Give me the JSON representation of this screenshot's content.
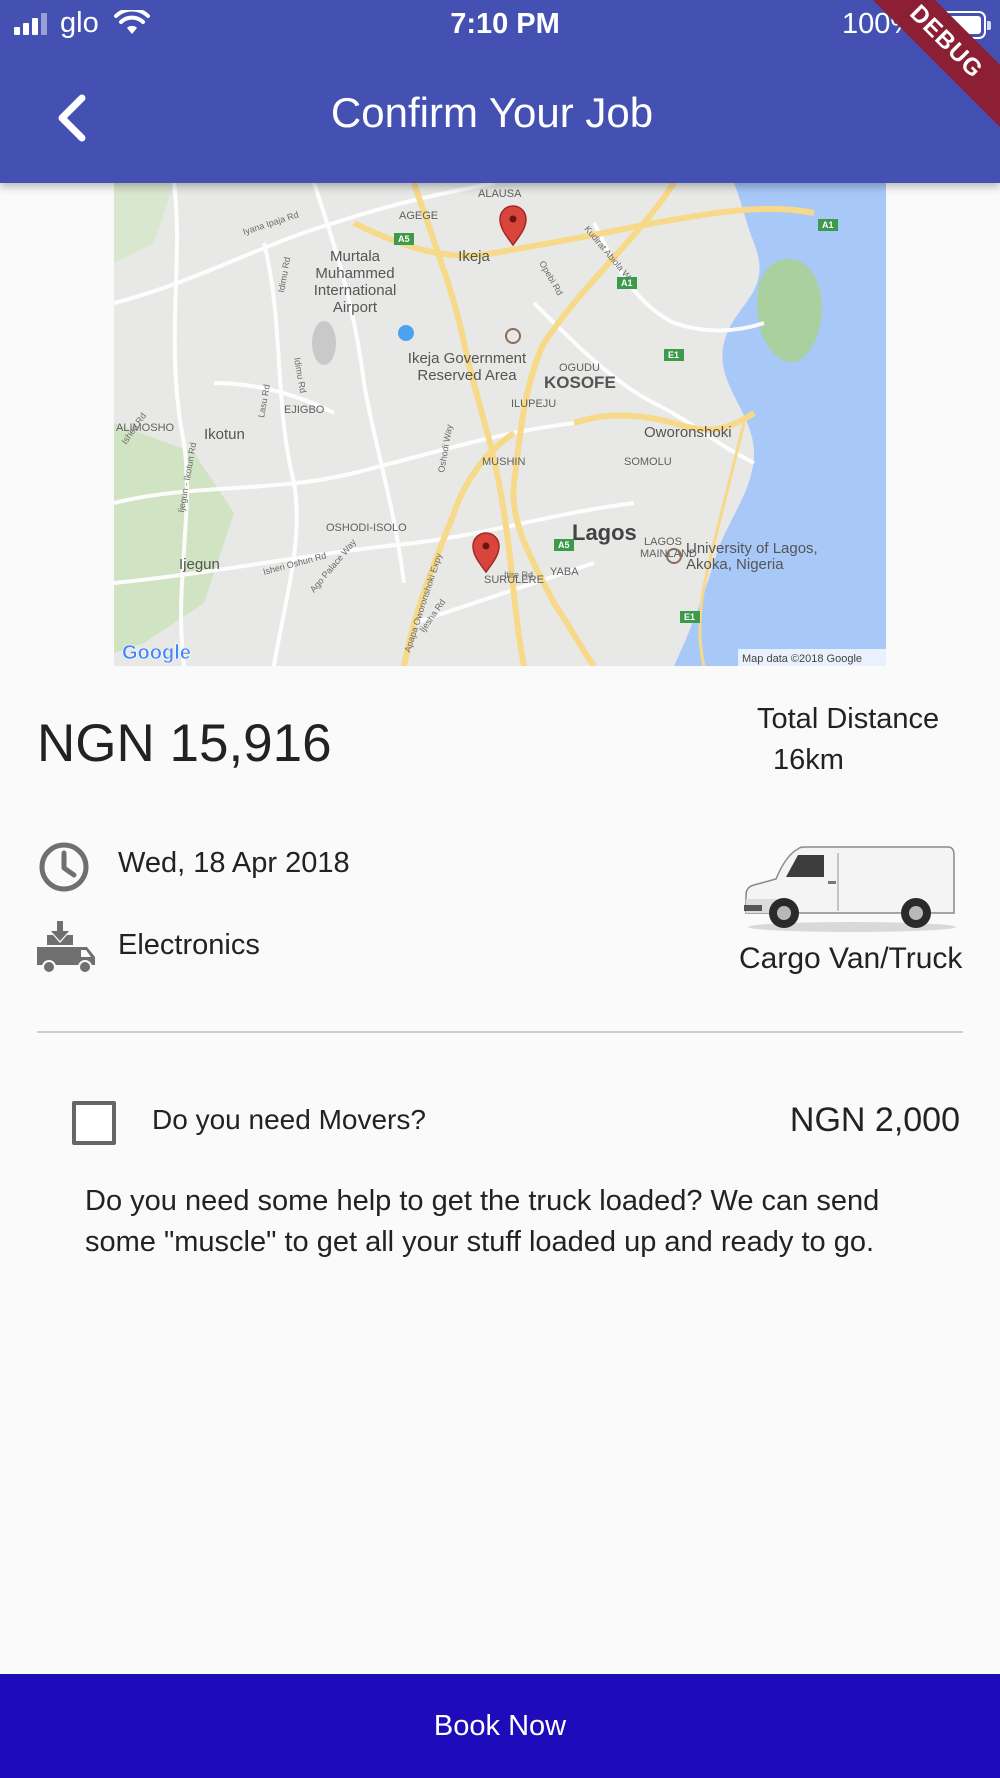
{
  "status_bar": {
    "carrier": "glo",
    "time": "7:10 PM",
    "battery_percent": "100%"
  },
  "app_bar": {
    "title": "Confirm Your Job",
    "debug_banner": "DEBUG"
  },
  "map": {
    "labels": {
      "alausa": "ALAUSA",
      "agege": "AGEGE",
      "airport_1": "Murtala",
      "airport_2": "Muhammed",
      "airport_3": "International",
      "airport_4": "Airport",
      "ikeja": "Ikeja",
      "gra_1": "Ikeja Government",
      "gra_2": "Reserved Area",
      "kosofe": "KOSOFE",
      "ogudu": "OGUDU",
      "oworonshoki": "Oworonshoki",
      "ikotun": "Ikotun",
      "ejigbo": "EJIGBO",
      "alimosho": "ALIMOSHO",
      "ilupeju": "ILUPEJU",
      "mushin": "MUSHIN",
      "somolu": "SOMOLU",
      "lagos": "Lagos",
      "unilag_1": "University of Lagos,",
      "unilag_2": "Akoka, Nigeria",
      "ijegun": "Ijegun",
      "oshodi": "OSHODI-ISOLO",
      "lagos_mainland_1": "LAGOS",
      "lagos_mainland_2": "MAINLAND",
      "yaba": "YABA",
      "surulere": "SURULERE",
      "apapa_exp": "Apapa Oworonshoki Expy",
      "iyana": "Iyana Ipaja Rd",
      "idimu": "Idimu Rd",
      "kudirat": "Kudirat Abiola Way",
      "opebi": "Opebi Rd",
      "ago_palace": "Ago Palace Way",
      "isheri": "Isheri Oshun Rd",
      "ijegun_ikotun": "Ijegun - Ikotun Rd",
      "lasu": "Lasu Rd",
      "oshodi_way": "Oshodi Way",
      "ishen": "Ishen Rd",
      "itire": "Itire Rd",
      "ijesha": "Ijesha Rd",
      "road_a1_1": "A1",
      "road_a1_2": "A1",
      "road_a5_1": "A5",
      "road_a5_2": "A5",
      "road_e1_1": "E1",
      "road_e1_2": "E1",
      "google": "Google",
      "attribution": "Map data ©2018 Google"
    },
    "colors": {
      "land": "#e8e8e6",
      "water": "#a8c8f8",
      "park": "#c6e2b4",
      "road": "#ffffff",
      "highway": "#f7d98a",
      "pin": "#d9453c"
    }
  },
  "job": {
    "price": "NGN 15,916",
    "total_distance_label": "Total Distance",
    "total_distance_value": "16km",
    "date": "Wed, 18 Apr 2018",
    "category": "Electronics",
    "vehicle": "Cargo Van/Truck"
  },
  "movers": {
    "question": "Do you need Movers?",
    "price": "NGN 2,000",
    "description": "Do you need some help to get the truck loaded? We can send some \"muscle\" to get all your stuff loaded up and ready to go.",
    "checked": false
  },
  "footer": {
    "book_label": "Book Now",
    "button_color": "#1e0cba"
  },
  "icons": {
    "back": "chevron-left-icon",
    "date": "clock-icon",
    "category": "truck-loading-icon",
    "vehicle": "van-image"
  },
  "theme": {
    "app_bar_color": "#4451b2"
  }
}
